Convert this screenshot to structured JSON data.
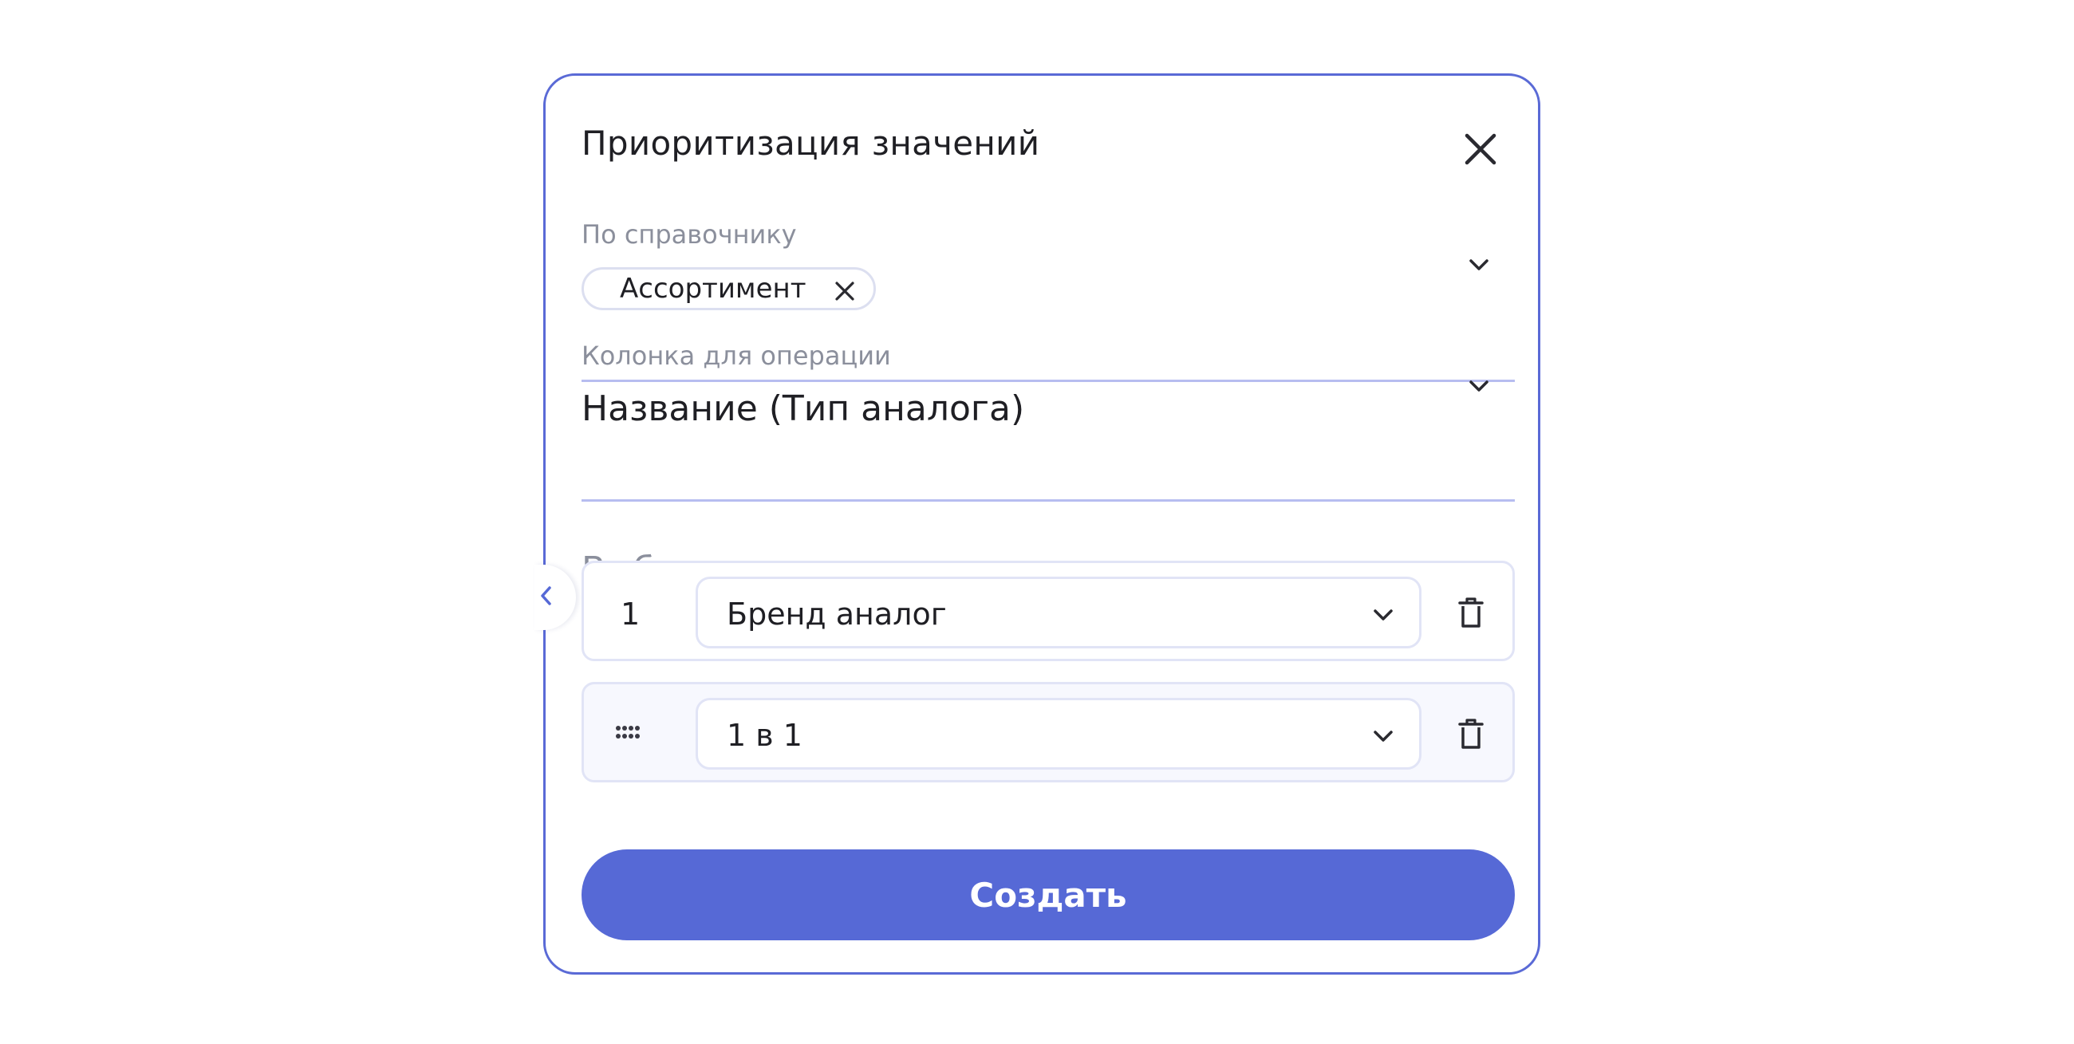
{
  "dialog": {
    "title": "Приоритизация значений",
    "close_icon": "close-icon"
  },
  "reference_field": {
    "label": "По справочнику",
    "chip_label": "Ассортимент",
    "chip_remove_icon": "close-icon",
    "chevron_icon": "chevron-down-icon"
  },
  "column_field": {
    "label": "Колонка для операции",
    "value": "Название (Тип аналога)",
    "chevron_icon": "chevron-down-icon"
  },
  "value_field": {
    "placeholder": "Выберите значение",
    "chevron_icon": "chevron-down-icon"
  },
  "priority_list": [
    {
      "rank": "1",
      "value": "Бренд аналог",
      "delete_icon": "trash-icon"
    },
    {
      "rank_icon": "drag-handle-icon",
      "value": "1 в 1",
      "delete_icon": "trash-icon"
    }
  ],
  "side_toggle_icon": "chevron-left-icon",
  "create_button": {
    "label": "Создать"
  },
  "colors": {
    "accent": "#5669d6",
    "border": "#5a6ad6",
    "muted_text": "#8b8f9c"
  }
}
